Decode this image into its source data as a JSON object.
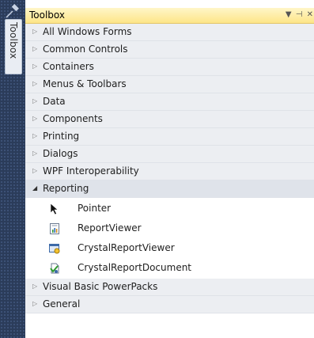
{
  "dock": {
    "tab_label": "Toolbox"
  },
  "window": {
    "title": "Toolbox",
    "title_icons": "▼ ⊣ ✕"
  },
  "categories_top": [
    {
      "label": "All Windows Forms"
    },
    {
      "label": "Common Controls"
    },
    {
      "label": "Containers"
    },
    {
      "label": "Menus & Toolbars"
    },
    {
      "label": "Data"
    },
    {
      "label": "Components"
    },
    {
      "label": "Printing"
    },
    {
      "label": "Dialogs"
    },
    {
      "label": "WPF Interoperability"
    }
  ],
  "expanded_category": {
    "label": "Reporting",
    "items": [
      {
        "label": "Pointer",
        "icon": "pointer-icon"
      },
      {
        "label": "ReportViewer",
        "icon": "report-viewer-icon"
      },
      {
        "label": "CrystalReportViewer",
        "icon": "crystal-report-viewer-icon"
      },
      {
        "label": "CrystalReportDocument",
        "icon": "crystal-report-document-icon"
      }
    ]
  },
  "categories_bottom": [
    {
      "label": "Visual Basic PowerPacks"
    },
    {
      "label": "General"
    }
  ],
  "icons": {
    "collapsed_arrow": "▷",
    "expanded_arrow": "◢"
  },
  "colors": {
    "dock_strip": "#2b3c5a",
    "titlebar_top": "#fff6c8",
    "titlebar_bottom": "#fde588",
    "category_bg": "#eceef2"
  }
}
